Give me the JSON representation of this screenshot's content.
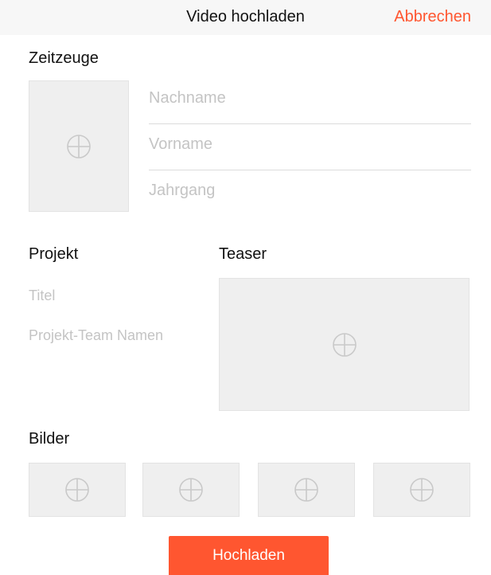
{
  "navbar": {
    "title": "Video hochladen",
    "cancel_label": "Abbrechen"
  },
  "witness": {
    "heading": "Zeitzeuge",
    "photo_icon": "plus-circle-icon",
    "lastname_placeholder": "Nachname",
    "firstname_placeholder": "Vorname",
    "year_placeholder": "Jahrgang"
  },
  "project": {
    "heading": "Projekt",
    "title_placeholder": "Titel",
    "team_placeholder": "Projekt-Team Namen"
  },
  "teaser": {
    "heading": "Teaser",
    "icon": "plus-circle-icon"
  },
  "images": {
    "heading": "Bilder",
    "slot_icon": "plus-circle-icon"
  },
  "upload_label": "Hochladen",
  "colors": {
    "accent": "#ff5630",
    "placeholder_text": "#c4c4c4",
    "box_background": "#efefef"
  }
}
